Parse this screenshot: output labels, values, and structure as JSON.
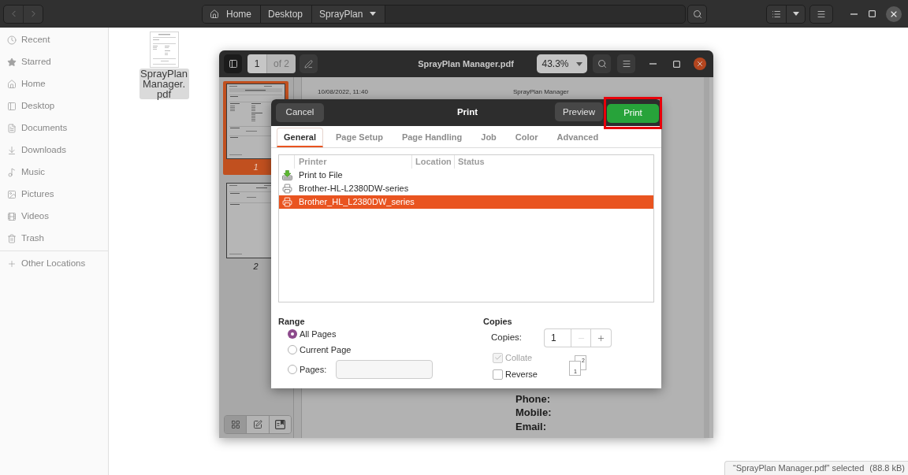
{
  "file_manager": {
    "path": [
      {
        "label": "Home",
        "kind": "home"
      },
      {
        "label": "Desktop",
        "kind": "folder"
      },
      {
        "label": "SprayPlan",
        "kind": "current"
      }
    ],
    "sidebar": {
      "items": [
        {
          "label": "Recent",
          "kind": "recent"
        },
        {
          "label": "Starred",
          "kind": "starred"
        },
        {
          "label": "Home",
          "kind": "home"
        },
        {
          "label": "Desktop",
          "kind": "desktop"
        },
        {
          "label": "Documents",
          "kind": "documents"
        },
        {
          "label": "Downloads",
          "kind": "downloads"
        },
        {
          "label": "Music",
          "kind": "music"
        },
        {
          "label": "Pictures",
          "kind": "pictures"
        },
        {
          "label": "Videos",
          "kind": "videos"
        },
        {
          "label": "Trash",
          "kind": "trash"
        }
      ],
      "other_locations": {
        "label": "Other Locations"
      }
    },
    "files": [
      {
        "name": "SprayPlan Manager.pdf",
        "selected": true
      }
    ],
    "status": {
      "text": "“SprayPlan Manager.pdf” selected",
      "size": "(88.8 kB)"
    }
  },
  "document_viewer": {
    "sidebar_toggle": {
      "on": true
    },
    "page_number": "1",
    "page_count": "of 2",
    "title": "SprayPlan Manager.pdf",
    "zoom": "43.3%",
    "thumbnails": [
      {
        "label": "1",
        "selected": true
      },
      {
        "label": "2",
        "selected": false
      }
    ],
    "sidebar_views": [
      {
        "kind": "thumbnails",
        "selected": true
      },
      {
        "kind": "annotations",
        "selected": false
      },
      {
        "kind": "bookmarks",
        "selected": false
      }
    ],
    "page": {
      "timestamp": "10/08/2022, 11:40",
      "header": "SprayPlan Manager",
      "fields": [
        "Phone:",
        "Mobile:",
        "Email:"
      ]
    }
  },
  "print_dialog": {
    "cancel": "Cancel",
    "title": "Print",
    "preview": "Preview",
    "print_button": {
      "label": "Print",
      "highlighted": true
    },
    "tabs": [
      {
        "label": "General",
        "selected": true
      },
      {
        "label": "Page Setup",
        "selected": false
      },
      {
        "label": "Page Handling",
        "selected": false
      },
      {
        "label": "Job",
        "selected": false
      },
      {
        "label": "Color",
        "selected": false
      },
      {
        "label": "Advanced",
        "selected": false
      }
    ],
    "printer_table": {
      "columns": [
        "Printer",
        "Location",
        "Status"
      ],
      "rows": [
        {
          "kind": "file",
          "name": "Print to File",
          "selected": false
        },
        {
          "kind": "printer",
          "name": "Brother-HL-L2380DW-series",
          "selected": false
        },
        {
          "kind": "printer",
          "name": "Brother_HL_L2380DW_series",
          "selected": true
        }
      ]
    },
    "range": {
      "title": "Range",
      "options": [
        {
          "kind": "plain",
          "label": "All Pages",
          "selected": true
        },
        {
          "kind": "plain",
          "label": "Current Page",
          "selected": false
        },
        {
          "kind": "pages",
          "label": "Pages:",
          "selected": false
        }
      ]
    },
    "copies": {
      "title": "Copies",
      "label": "Copies:",
      "value": "1",
      "decrement_disabled": true,
      "collate": {
        "label": "Collate",
        "checked": true,
        "disabled": true
      },
      "reverse": {
        "label": "Reverse",
        "checked": false,
        "disabled": false
      },
      "collate_preview": [
        "1",
        "2"
      ]
    }
  }
}
